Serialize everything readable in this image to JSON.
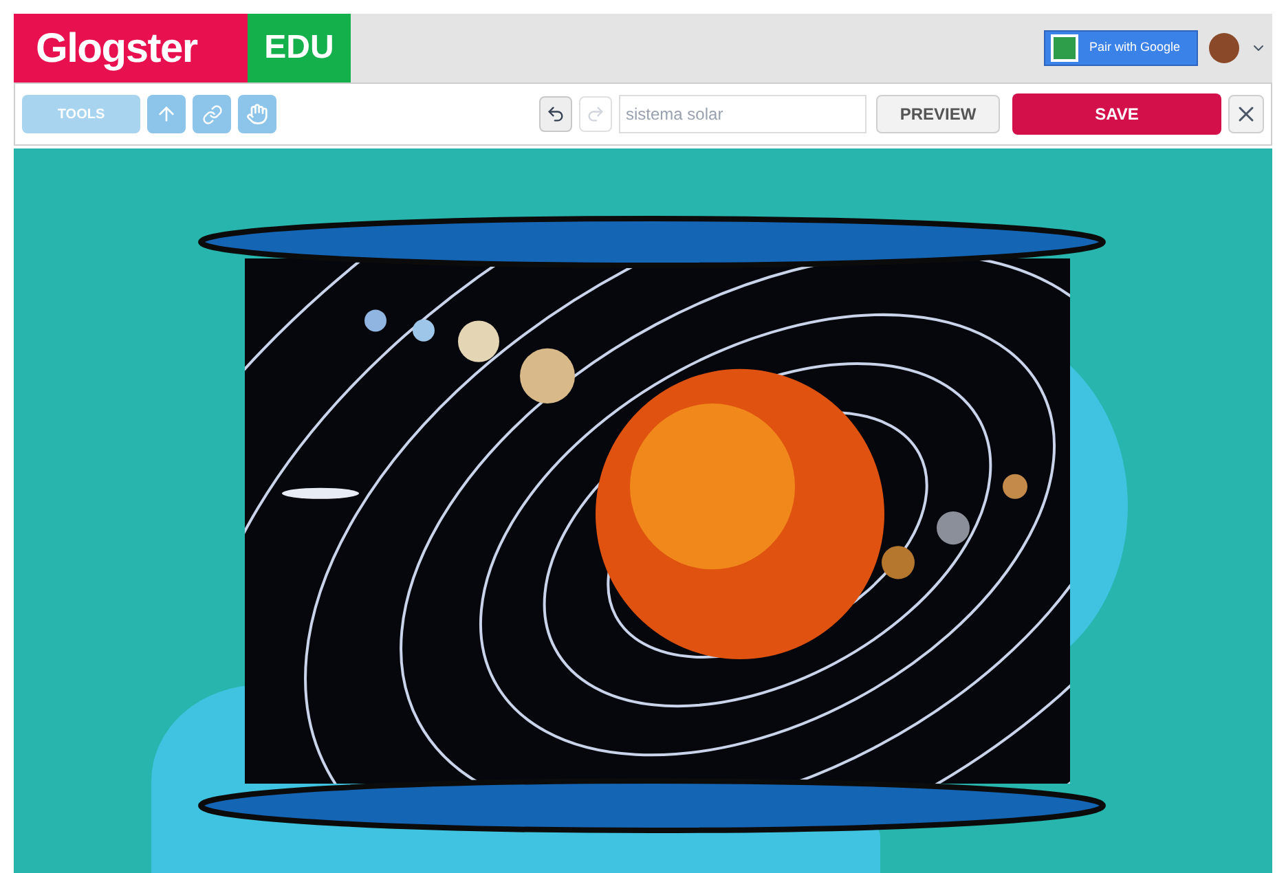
{
  "header": {
    "logo": "Glogster",
    "badge": "EDU",
    "google_button": "Pair with Google"
  },
  "toolbar": {
    "tools_button": "TOOLS",
    "history": [
      {
        "kind": "undo",
        "disabled": false
      },
      {
        "kind": "redo",
        "disabled": true
      }
    ],
    "title_field": {
      "value": "sistema solar"
    },
    "preview_button": "PREVIEW",
    "save_button": "SAVE"
  }
}
